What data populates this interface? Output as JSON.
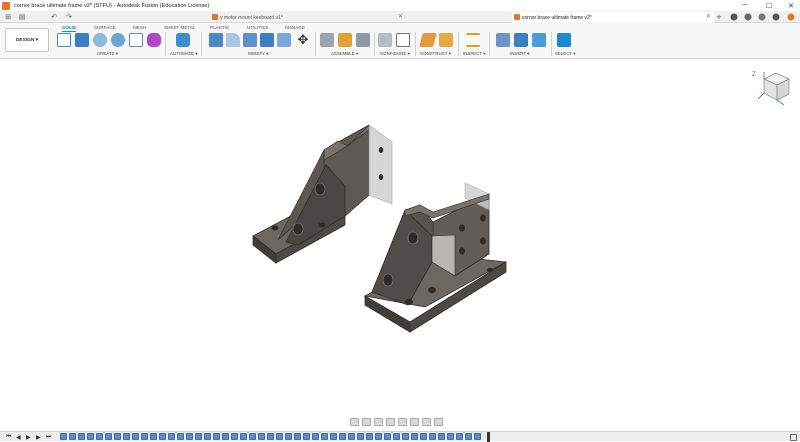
{
  "window": {
    "title": "cornor brace ultimate frame v2* (STFU) - Autodesk Fusion (Education License)",
    "controls": {
      "minimize": "─",
      "maximize": "☐",
      "close": "✕"
    }
  },
  "tabs": [
    {
      "label": "y motor mount keeboard v1*",
      "active": false,
      "close": "✕"
    },
    {
      "label": "cornor brace ultimate frame v2*",
      "active": true,
      "close": "✕"
    }
  ],
  "tabbar_icons": {
    "grid": "⊞",
    "file": "▤",
    "undo": "↶",
    "redo": "↷",
    "new_tab": "+"
  },
  "workspace": {
    "label": "DESIGN ▾"
  },
  "workspace_tabs": [
    "SOLID",
    "SURFACE",
    "MESH",
    "SHEET METAL",
    "PLASTIC",
    "UTILITIES",
    "MANAGE"
  ],
  "tool_groups": [
    "CREATE ▾",
    "AUTOMATE ▾",
    "MODIFY ▾",
    "ASSEMBLE ▾",
    "CONFIGURE ▾",
    "CONSTRUCT ▾",
    "INSPECT ▾",
    "INSERT ▾",
    "SELECT ▾"
  ],
  "viewcube": {
    "axis": "Z"
  },
  "colors": {
    "accent": "#0696d7",
    "brand": "#e8742a",
    "part": "#5a5752",
    "part_light": "#7a766f",
    "part_dark": "#3a3835",
    "timeline_item": "#5b8fc7"
  }
}
